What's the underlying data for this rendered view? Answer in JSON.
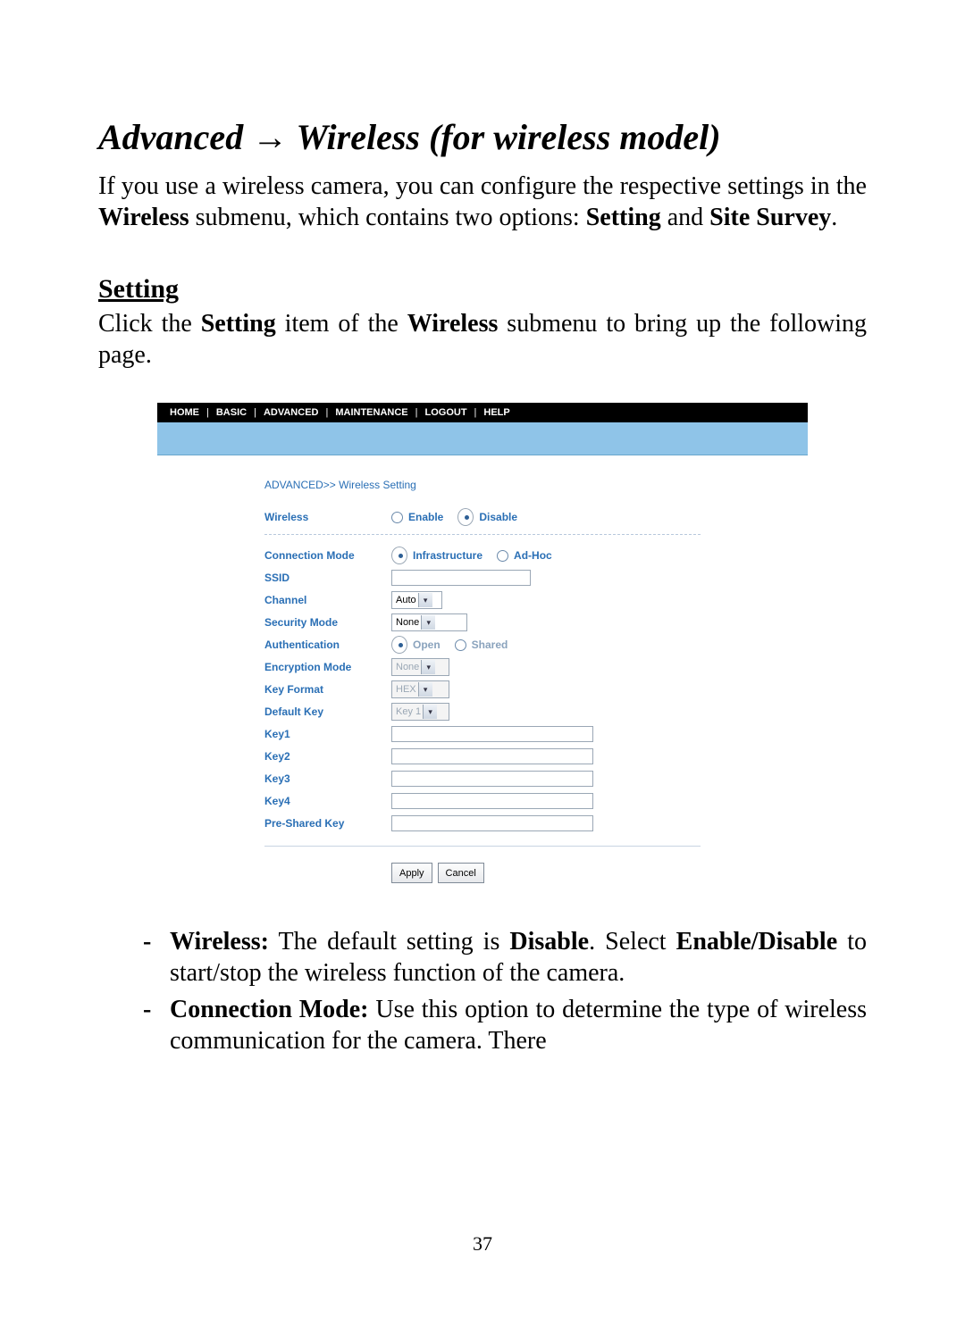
{
  "title": {
    "part1": "Advanced ",
    "arrow": "→",
    "part2": " Wireless (for wireless model)"
  },
  "intro": {
    "pre": "If you use a wireless camera, you can configure the respective settings in the ",
    "b1": "Wireless",
    "mid": " submenu, which contains two options: ",
    "b2": "Setting",
    "and": " and ",
    "b3": "Site Survey",
    "post": "."
  },
  "setting_heading": "Setting",
  "setting_para": {
    "pre": "Click the ",
    "b1": "Setting",
    "mid": " item of the ",
    "b2": "Wireless",
    "post": " submenu to bring up the following page."
  },
  "nav": {
    "home": "HOME",
    "basic": "BASIC",
    "advanced": "ADVANCED",
    "maintenance": "MAINTENANCE",
    "logout": "LOGOUT",
    "help": "HELP",
    "sep": "|"
  },
  "breadcrumb": "ADVANCED>> Wireless Setting",
  "form": {
    "wireless": {
      "label": "Wireless",
      "enable": "Enable",
      "disable": "Disable",
      "enable_selected": false,
      "disable_selected": true
    },
    "connmode": {
      "label": "Connection Mode",
      "infra": "Infrastructure",
      "adhoc": "Ad-Hoc",
      "infra_selected": true,
      "adhoc_selected": false
    },
    "ssid": {
      "label": "SSID",
      "value": ""
    },
    "channel": {
      "label": "Channel",
      "value": "Auto"
    },
    "security": {
      "label": "Security Mode",
      "value": "None"
    },
    "auth": {
      "label": "Authentication",
      "open": "Open",
      "shared": "Shared",
      "open_selected": true,
      "shared_selected": false
    },
    "encmode": {
      "label": "Encryption Mode",
      "value": "None"
    },
    "keyfmt": {
      "label": "Key Format",
      "value": "HEX"
    },
    "defkey": {
      "label": "Default Key",
      "value": "Key 1"
    },
    "key1": {
      "label": "Key1",
      "value": ""
    },
    "key2": {
      "label": "Key2",
      "value": ""
    },
    "key3": {
      "label": "Key3",
      "value": ""
    },
    "key4": {
      "label": "Key4",
      "value": ""
    },
    "psk": {
      "label": "Pre-Shared Key",
      "value": ""
    },
    "apply": "Apply",
    "cancel": "Cancel"
  },
  "bullets": {
    "b1": {
      "lead": "Wireless:",
      "t1": " The default setting is ",
      "b1": "Disable",
      "t2": ".  Select ",
      "b2": "Enable/Disable",
      "t3": " to start/stop the wireless function of the camera."
    },
    "b2": {
      "lead": "Connection Mode:",
      "t1": " Use this option to determine the type of wireless communication for the camera.  There"
    }
  },
  "page_number": "37"
}
